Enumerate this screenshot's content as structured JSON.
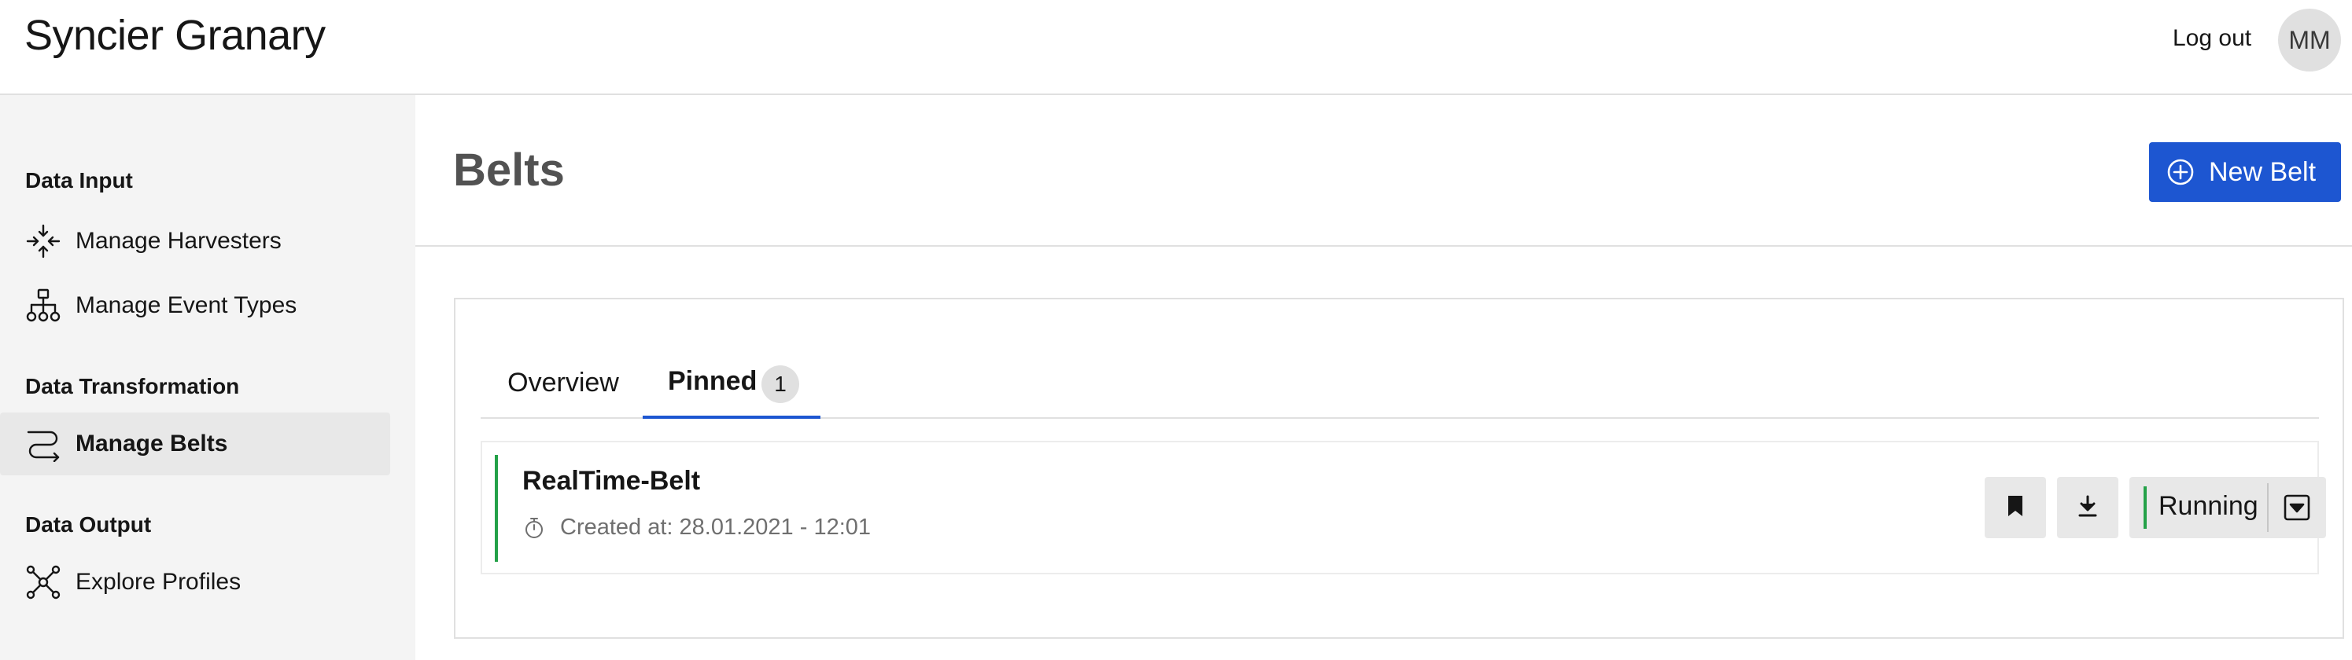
{
  "header": {
    "app_title": "Syncier Granary",
    "logout_label": "Log out",
    "avatar_initials": "MM"
  },
  "sidebar": {
    "sections": [
      {
        "title": "Data Input",
        "items": [
          {
            "label": "Manage Harvesters",
            "icon": "harvester-icon"
          },
          {
            "label": "Manage Event Types",
            "icon": "hierarchy-icon"
          }
        ]
      },
      {
        "title": "Data Transformation",
        "items": [
          {
            "label": "Manage Belts",
            "icon": "belt-route-icon",
            "active": true
          }
        ]
      },
      {
        "title": "Data Output",
        "items": [
          {
            "label": "Explore Profiles",
            "icon": "network-icon"
          }
        ]
      }
    ]
  },
  "page": {
    "title": "Belts",
    "new_button_label": "New Belt"
  },
  "tabs": [
    {
      "label": "Overview",
      "selected": false
    },
    {
      "label": "Pinned",
      "badge": "1",
      "selected": true
    }
  ],
  "belts": [
    {
      "name": "RealTime-Belt",
      "created": "Created at: 28.01.2021 - 12:01",
      "status": "Running",
      "status_color": "#24a148"
    }
  ],
  "colors": {
    "primary": "#1d56d1",
    "running": "#24a148",
    "sidebar_bg": "#f4f4f4"
  }
}
